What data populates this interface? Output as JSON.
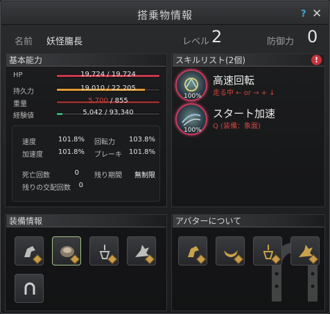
{
  "window": {
    "title": "搭乗物情報",
    "help_label": "?",
    "close_label": "✕"
  },
  "header": {
    "name_label": "名前",
    "name_value": "妖怪膓長",
    "level_label": "レベル",
    "level_value": "2",
    "defense_label": "防御力",
    "defense_value": "0"
  },
  "basic": {
    "title": "基本能力",
    "bars": [
      {
        "label": "HP",
        "text": "19,724 / 19,724",
        "fraction": 1.0,
        "color": "#c9394a"
      },
      {
        "label": "持久力",
        "text": "19,010 / 22,205",
        "fraction": 0.856,
        "color": "#e49b35"
      },
      {
        "label": "重量",
        "text_current": "5,700",
        "text_sep": " / ",
        "text_max": "855",
        "fraction": 1.0,
        "color": "#8a2d2d",
        "current_color": "#d04040"
      },
      {
        "label": "経験値",
        "text": "5,042 / 93,340",
        "fraction": 0.054,
        "color": "#2fb37a"
      }
    ],
    "stats": {
      "speed_label": "速度",
      "speed_value": "101.8%",
      "turn_label": "回転力",
      "turn_value": "103.8%",
      "accel_label": "加速度",
      "accel_value": "101.8%",
      "brake_label": "ブレーキ",
      "brake_value": "101.8%",
      "deaths_label": "死亡回数",
      "deaths_value": "0",
      "period_label": "残り期間",
      "period_value": "無制限",
      "breeding_label": "残りの交配回数",
      "breeding_value": "0"
    }
  },
  "skills": {
    "title": "スキルリスト(2個)",
    "alert_label": "!",
    "items": [
      {
        "name": "高速回転",
        "key": "走る中 ← or → + ↓",
        "pct": "100%"
      },
      {
        "name": "スタート加速",
        "key": "Q (装備：象面)",
        "pct": "100%"
      }
    ]
  },
  "equipment": {
    "title": "装備情報"
  },
  "avatar": {
    "title": "アバターについて"
  },
  "colors": {
    "accent_ring": "#c93a5c",
    "help": "#3fa9d9",
    "alert": "#c8323a"
  }
}
